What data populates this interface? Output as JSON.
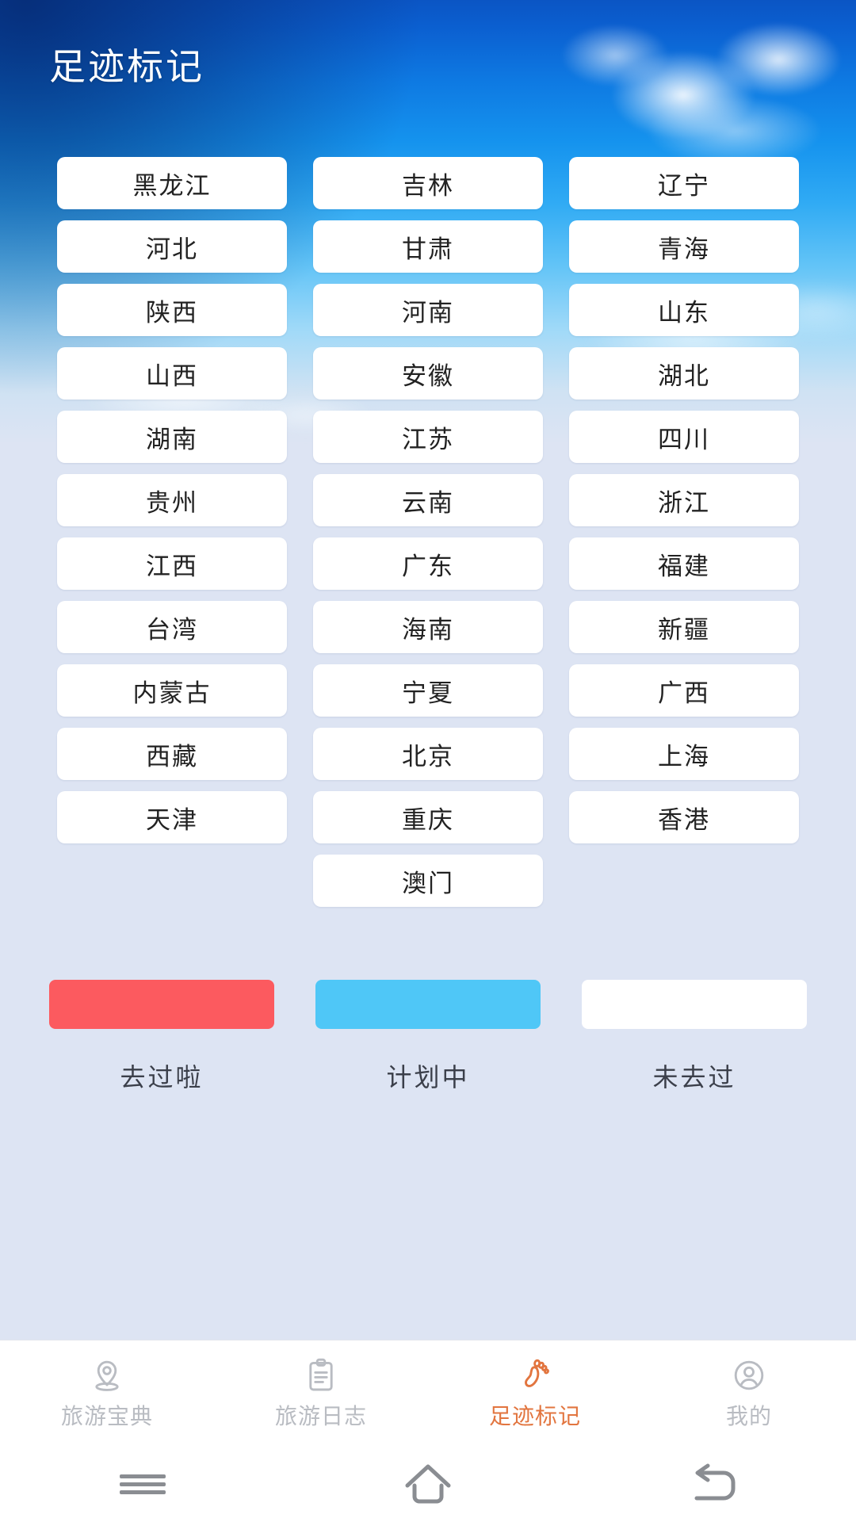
{
  "header": {
    "title": "足迹标记"
  },
  "grid": {
    "rows": [
      [
        "黑龙江",
        "吉林",
        "辽宁"
      ],
      [
        "河北",
        "甘肃",
        "青海"
      ],
      [
        "陕西",
        "河南",
        "山东"
      ],
      [
        "山西",
        "安徽",
        "湖北"
      ],
      [
        "湖南",
        "江苏",
        "四川"
      ],
      [
        "贵州",
        "云南",
        "浙江"
      ],
      [
        "江西",
        "广东",
        "福建"
      ],
      [
        "台湾",
        "海南",
        "新疆"
      ],
      [
        "内蒙古",
        "宁夏",
        "广西"
      ],
      [
        "西藏",
        "北京",
        "上海"
      ],
      [
        "天津",
        "重庆",
        "香港"
      ],
      [
        "",
        "澳门",
        ""
      ]
    ]
  },
  "legend": {
    "items": [
      {
        "label": "去过啦",
        "color": "#FC5A5F"
      },
      {
        "label": "计划中",
        "color": "#4FC7F7"
      },
      {
        "label": "未去过",
        "color": "#FFFFFF"
      }
    ]
  },
  "tabbar": {
    "active_color": "#E2753F",
    "inactive_color": "#B9BCC2",
    "items": [
      {
        "label": "旅游宝典",
        "icon": "map-pin-icon",
        "active": false
      },
      {
        "label": "旅游日志",
        "icon": "clipboard-icon",
        "active": false
      },
      {
        "label": "足迹标记",
        "icon": "footprint-icon",
        "active": true
      },
      {
        "label": "我的",
        "icon": "user-circle-icon",
        "active": false
      }
    ]
  },
  "system_nav": {
    "buttons": [
      "recents-icon",
      "home-icon",
      "back-icon"
    ]
  }
}
